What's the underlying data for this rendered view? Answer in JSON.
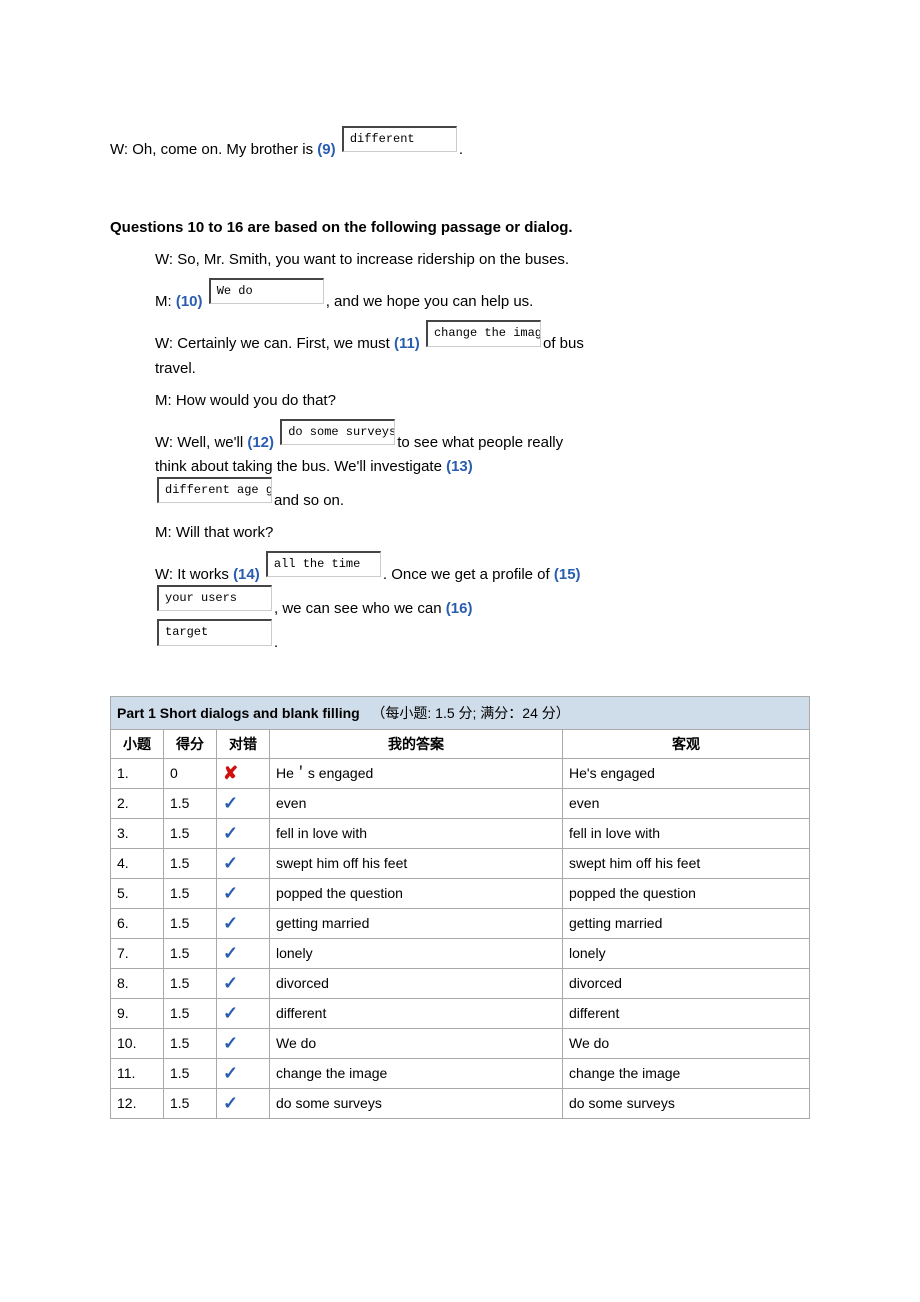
{
  "dialog1": {
    "line9_prefix": "W: Oh, come on. My brother is ",
    "q9": "(9)",
    "input9": "different",
    "line9_suffix": "."
  },
  "heading2": "Questions 10 to 16 are based on the following passage or dialog.",
  "dialog2": {
    "l1": "W: So, Mr. Smith, you want to increase ridership on the buses.",
    "l2a": "M: ",
    "q10": "(10)",
    "in10": "We do",
    "l2b": ", and we hope you can help us.",
    "l3a": "W: Certainly we can. First, we must ",
    "q11": "(11)",
    "in11": "change the imag",
    "l3b": "of bus travel.",
    "l4": "M: How would you do that?",
    "l5a": "W: Well, we'll ",
    "q12": "(12)",
    "in12": "do some surveys",
    "l5b": "to see what people really think about taking the bus. We'll investigate ",
    "q13": "(13)",
    "in13": "different age g",
    "l5c": "and so on.",
    "l6": "M: Will that work?",
    "l7a": "W: It works ",
    "q14": "(14)",
    "in14": "all the time",
    "l7b": ". Once we get a profile of ",
    "q15": "(15)",
    "in15": "your users",
    "l7c": ", we can see who we can ",
    "q16": "(16)",
    "in16": "target",
    "l7d": "."
  },
  "table": {
    "title": "Part 1 Short dialogs and blank filling",
    "sub": "（每小题: 1.5  分;  满分：24 分）",
    "cols": {
      "q": "小题",
      "pts": "得分",
      "mark": "对错",
      "my": "我的答案",
      "ans": "客观"
    },
    "rows": [
      {
        "q": "1.",
        "pts": "0",
        "mark": "x",
        "my": "He＇s engaged",
        "ans": "He's engaged"
      },
      {
        "q": "2.",
        "pts": "1.5",
        "mark": "v",
        "my": "even",
        "ans": "even"
      },
      {
        "q": "3.",
        "pts": "1.5",
        "mark": "v",
        "my": "fell in love with",
        "ans": "fell in love with"
      },
      {
        "q": "4.",
        "pts": "1.5",
        "mark": "v",
        "my": "swept him off his feet",
        "ans": "swept him off his feet"
      },
      {
        "q": "5.",
        "pts": "1.5",
        "mark": "v",
        "my": "popped the question",
        "ans": "popped the question"
      },
      {
        "q": "6.",
        "pts": "1.5",
        "mark": "v",
        "my": "getting married",
        "ans": "getting married"
      },
      {
        "q": "7.",
        "pts": "1.5",
        "mark": "v",
        "my": "lonely",
        "ans": "lonely"
      },
      {
        "q": "8.",
        "pts": "1.5",
        "mark": "v",
        "my": "divorced",
        "ans": "divorced"
      },
      {
        "q": "9.",
        "pts": "1.5",
        "mark": "v",
        "my": "different",
        "ans": "different"
      },
      {
        "q": "10.",
        "pts": "1.5",
        "mark": "v",
        "my": "We do",
        "ans": "We do"
      },
      {
        "q": "11.",
        "pts": "1.5",
        "mark": "v",
        "my": "change the image",
        "ans": "change the image"
      },
      {
        "q": "12.",
        "pts": "1.5",
        "mark": "v",
        "my": "do some surveys",
        "ans": "do some surveys"
      }
    ]
  }
}
